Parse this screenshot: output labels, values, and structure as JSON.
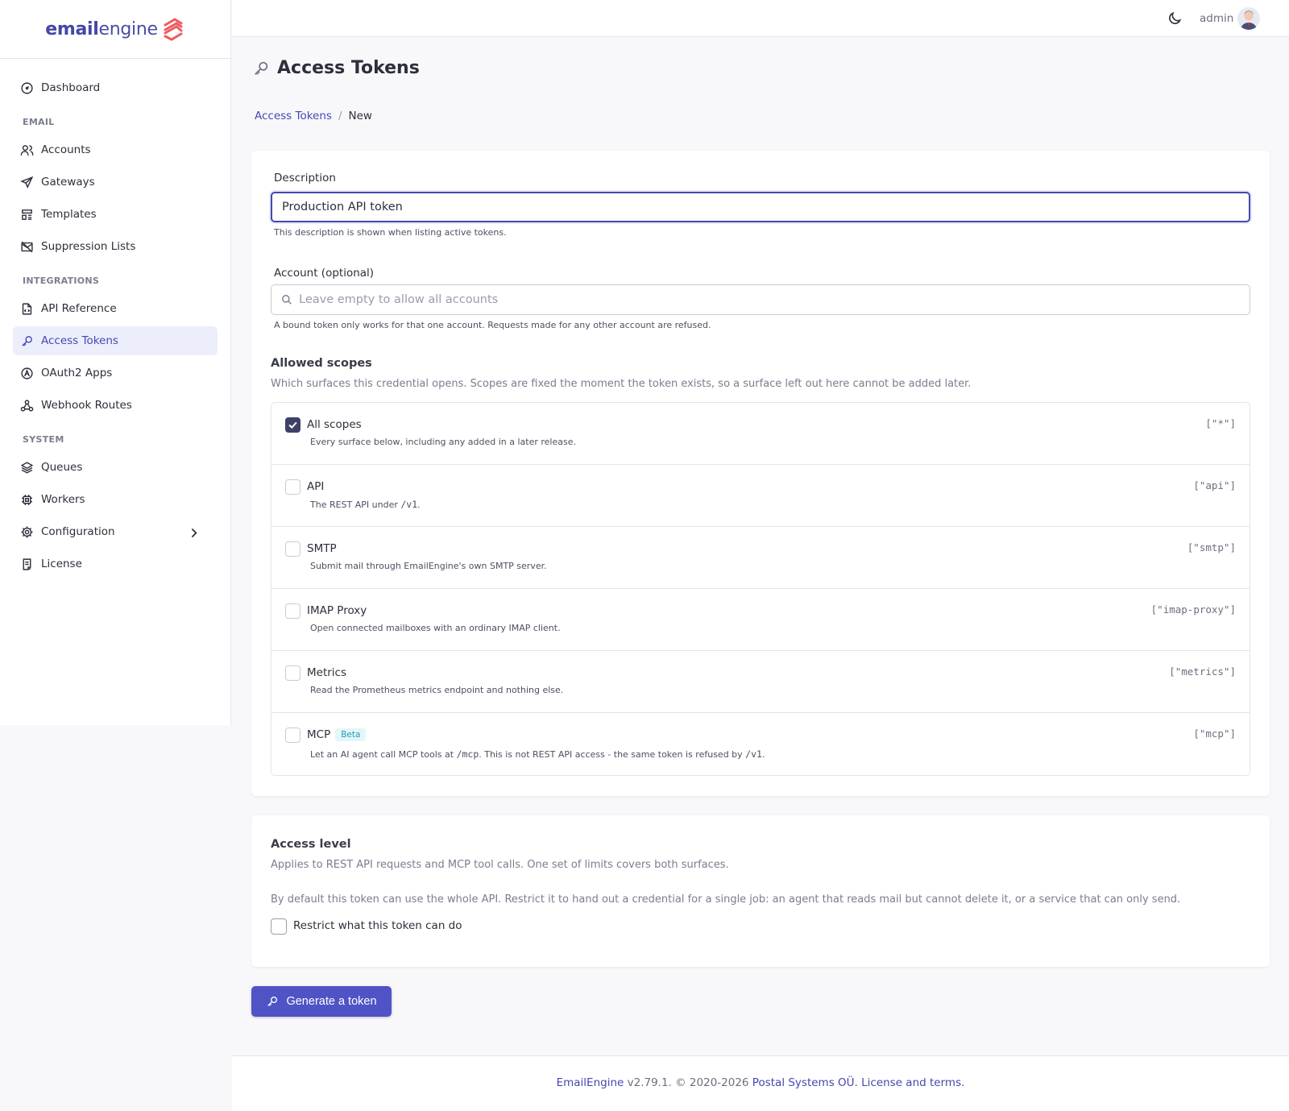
{
  "brand": {
    "logo_bold": "email",
    "logo_rest": "engine"
  },
  "sidebar": {
    "items": {
      "dashboard": "Dashboard",
      "accounts": "Accounts",
      "gateways": "Gateways",
      "templates": "Templates",
      "suppression": "Suppression Lists",
      "api_reference": "API Reference",
      "access_tokens": "Access Tokens",
      "oauth2": "OAuth2 Apps",
      "webhooks": "Webhook Routes",
      "queues": "Queues",
      "workers": "Workers",
      "configuration": "Configuration",
      "license": "License"
    },
    "sections": {
      "email": "EMAIL",
      "integrations": "INTEGRATIONS",
      "system": "SYSTEM"
    },
    "active": "access_tokens"
  },
  "topbar": {
    "user": "admin"
  },
  "page": {
    "title": "Access Tokens",
    "breadcrumb": {
      "parent": "Access Tokens",
      "separator": "/",
      "current": "New"
    }
  },
  "form": {
    "description": {
      "label": "Description",
      "value": "Production API token",
      "hint": "This description is shown when listing active tokens."
    },
    "account": {
      "label": "Account (optional)",
      "placeholder": "Leave empty to allow all accounts",
      "hint": "A bound token only works for that one account. Requests made for any other account are refused."
    },
    "scopes": {
      "title": "Allowed scopes",
      "desc": "Which surfaces this credential opens. Scopes are fixed the moment the token exists, so a surface left out here cannot be added later.",
      "items": [
        {
          "name": "All scopes",
          "desc": "Every surface below, including any added in a later release.",
          "code": "[\"*\"]",
          "checked": true
        },
        {
          "name": "API",
          "desc_pre": "The REST API under ",
          "desc_code": "/v1",
          "desc_post": ".",
          "code": "[\"api\"]",
          "checked": false
        },
        {
          "name": "SMTP",
          "desc": "Submit mail through EmailEngine's own SMTP server.",
          "code": "[\"smtp\"]",
          "checked": false
        },
        {
          "name": "IMAP Proxy",
          "desc": "Open connected mailboxes with an ordinary IMAP client.",
          "code": "[\"imap-proxy\"]",
          "checked": false
        },
        {
          "name": "Metrics",
          "desc": "Read the Prometheus metrics endpoint and nothing else.",
          "code": "[\"metrics\"]",
          "checked": false
        },
        {
          "name": "MCP",
          "badge": "Beta",
          "desc_pre": "Let an AI agent call MCP tools at ",
          "desc_code": "/mcp",
          "desc_mid": ". This is not REST API access - the same token is refused by ",
          "desc_code2": "/v1",
          "desc_post": ".",
          "code": "[\"mcp\"]",
          "checked": false
        }
      ]
    },
    "access_level": {
      "title": "Access level",
      "desc": "Applies to REST API requests and MCP tool calls. One set of limits covers both surfaces.",
      "info": "By default this token can use the whole API. Restrict it to hand out a credential for a single job: an agent that reads mail but cannot delete it, or a service that can only send.",
      "restrict_label": "Restrict what this token can do",
      "restrict_checked": false
    },
    "submit": "Generate a token"
  },
  "footer": {
    "product": "EmailEngine",
    "version_text": " v2.79.1. © 2020-2026 ",
    "company": "Postal Systems OÜ.",
    "license": "License and terms."
  },
  "colors": {
    "accent": "#4548b0",
    "button": "#4f53c6",
    "checkbox_checked": "#3e4166",
    "beta": "#1a9fb6"
  }
}
